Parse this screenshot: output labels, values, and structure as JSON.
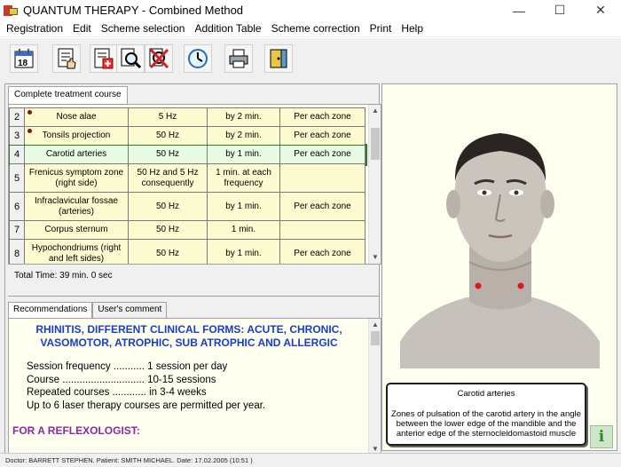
{
  "window": {
    "title": "QUANTUM THERAPY - Combined Method",
    "minimize": "—",
    "maximize": "☐",
    "close": "✕"
  },
  "menu": [
    "Registration",
    "Edit",
    "Scheme selection",
    "Addition Table",
    "Scheme correction",
    "Print",
    "Help"
  ],
  "toolbar": {
    "icons": [
      "calendar-icon",
      "notes-hand-icon",
      "new-record-icon",
      "search-icon",
      "delete-search-icon",
      "timer-icon",
      "printer-icon",
      "exit-door-icon"
    ]
  },
  "course_tab": {
    "label": "Complete treatment course"
  },
  "table": {
    "rows": [
      {
        "num": "2",
        "zone": "Nose alae",
        "freq": "5 Hz",
        "time": "by 2 min.",
        "note": "Per each zone",
        "marker": true
      },
      {
        "num": "3",
        "zone": "Tonsils projection",
        "freq": "50 Hz",
        "time": "by 2 min.",
        "note": "Per each zone",
        "marker": true
      },
      {
        "num": "4",
        "zone": "Carotid arteries",
        "freq": "50 Hz",
        "time": "by 1 min.",
        "note": "Per each zone",
        "marker": false,
        "selected": true
      },
      {
        "num": "5",
        "zone": "Frenicus symptom zone (right side)",
        "freq": "50 Hz and 5 Hz consequently",
        "time": "1 min. at each frequency",
        "note": "",
        "marker": false
      },
      {
        "num": "6",
        "zone": "Infraclavicular fossae (arteries)",
        "freq": "50 Hz",
        "time": "by 1 min.",
        "note": "Per each zone",
        "marker": false
      },
      {
        "num": "7",
        "zone": "Corpus sternum",
        "freq": "50 Hz",
        "time": "1 min.",
        "note": "",
        "marker": false
      },
      {
        "num": "8",
        "zone": "Hypochondriums (right and left sides)",
        "freq": "50 Hz",
        "time": "by 1 min.",
        "note": "Per each zone",
        "marker": false
      }
    ]
  },
  "total_time": "Total Time: 39 min. 0 sec",
  "bottom_tabs": [
    "Recommendations",
    "User's comment"
  ],
  "recommendations": {
    "title": "RHINITIS, DIFFERENT CLINICAL FORMS: ACUTE, CHRONIC, VASOMOTOR, ATROPHIC, SUB ATROPHIC AND ALLERGIC",
    "lines": [
      "Session frequency ........... 1 session per day",
      "Course ............................. 10-15 sessions",
      "Repeated courses ............ in 3-4 weeks",
      "Up to 6 laser therapy courses are permitted per year."
    ],
    "reflexologist": "FOR A REFLEXOLOGIST:"
  },
  "zone_info": {
    "title": "Carotid arteries",
    "text": "Zones of pulsation of the carotid artery in the angle between the lower edge of the mandible and the anterior edge of the sternocleidomastoid muscle",
    "info_icon": "i"
  },
  "status": {
    "text": "Doctor:  BARRETT STEPHEN.   Patient:  SMITH MICHAEL.   Date:  17.02.2005   (10:51 )"
  }
}
